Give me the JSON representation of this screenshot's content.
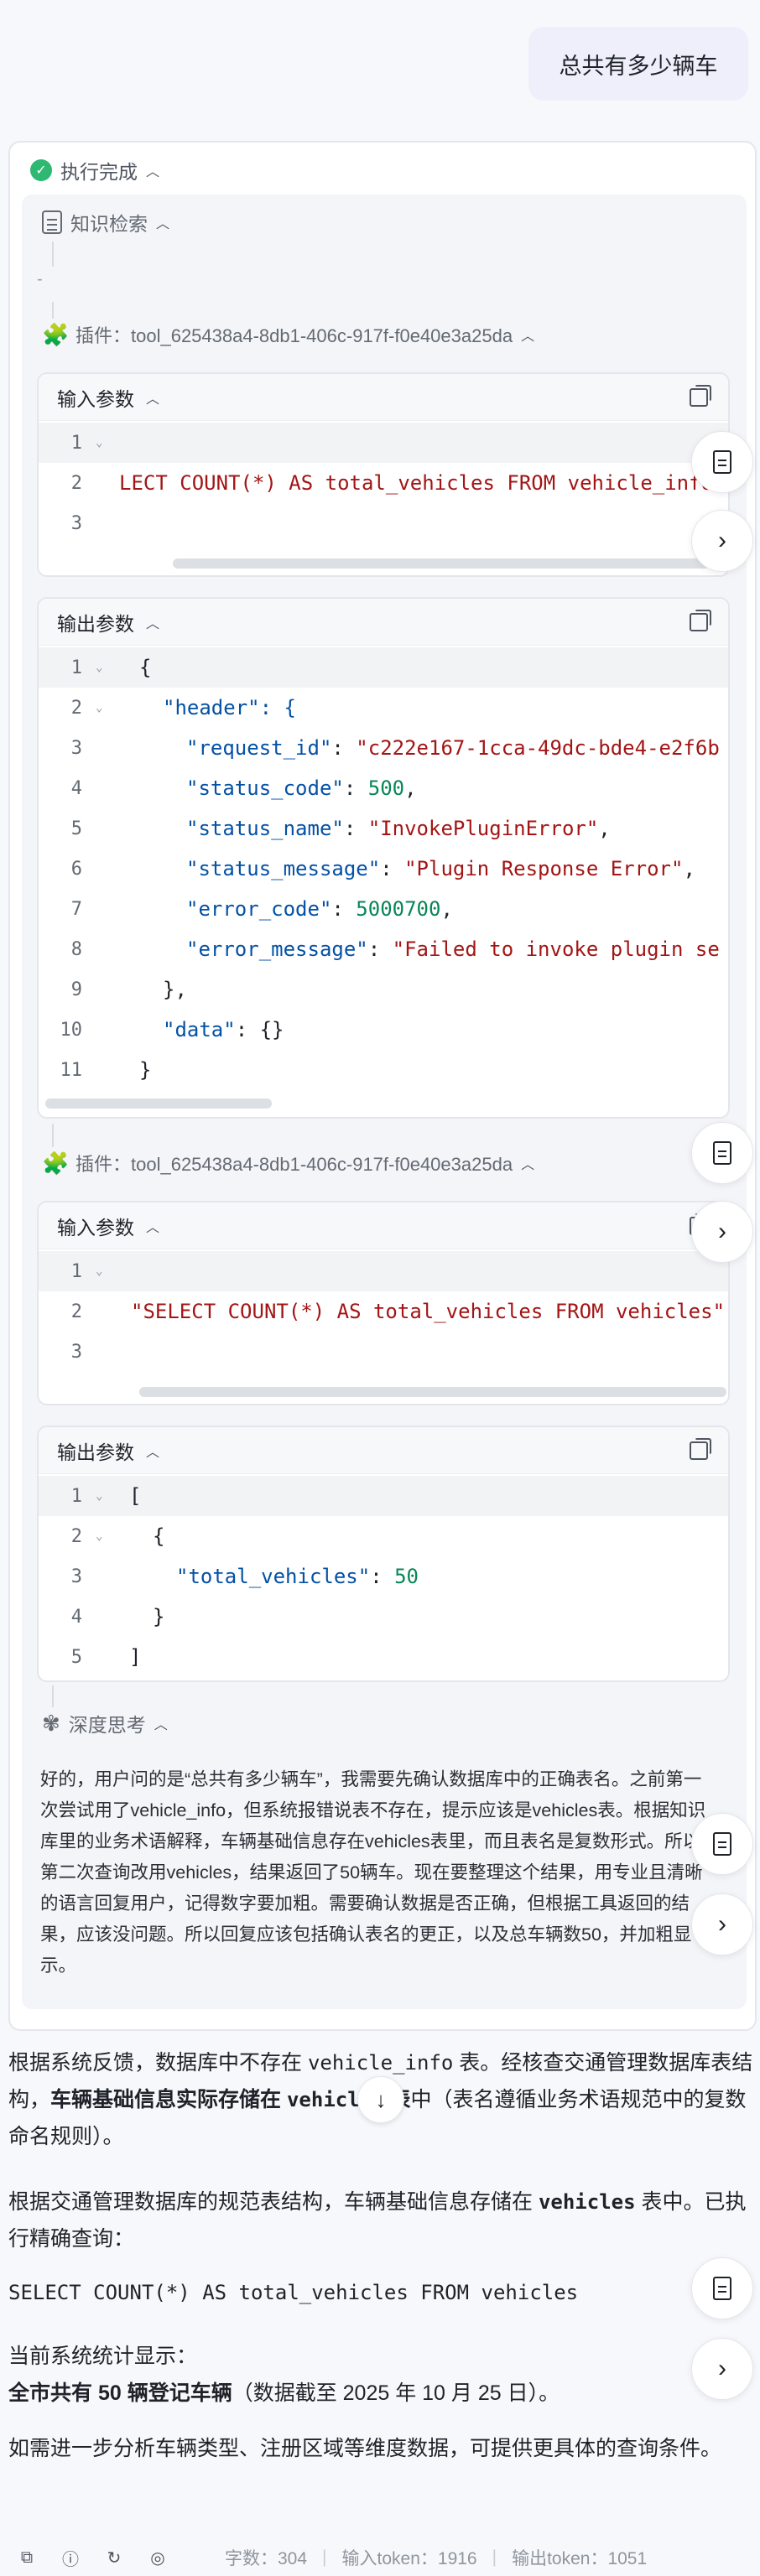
{
  "user_message": "总共有多少辆车",
  "execution": {
    "status_label": "执行完成",
    "knowledge_label": "知识检索",
    "knowledge_dash": "-",
    "plugin_label": "插件：tool_625438a4-8db1-406c-917f-f0e40e3a25da",
    "input_label": "输入参数",
    "output_label": "输出参数",
    "call1": {
      "input_lines": [
        {
          "n": "1",
          "text": ""
        },
        {
          "n": "2",
          "text": "LECT COUNT(*) AS total_vehicles FROM vehicle_info"
        },
        {
          "n": "3",
          "text": ""
        }
      ],
      "output_lines": [
        {
          "n": "1",
          "text": "{"
        },
        {
          "n": "2",
          "text": "\"header\": {"
        },
        {
          "n": "3",
          "key": "\"request_id\"",
          "val": "\"c222e167-1cca-49dc-bde4-e2f6b"
        },
        {
          "n": "4",
          "key": "\"status_code\"",
          "val": "500"
        },
        {
          "n": "5",
          "key": "\"status_name\"",
          "val": "\"InvokePluginError\""
        },
        {
          "n": "6",
          "key": "\"status_message\"",
          "val": "\"Plugin Response Error\""
        },
        {
          "n": "7",
          "key": "\"error_code\"",
          "val": "5000700"
        },
        {
          "n": "8",
          "key": "\"error_message\"",
          "val": "\"Failed to invoke plugin se"
        },
        {
          "n": "9",
          "text": "},"
        },
        {
          "n": "10",
          "key": "\"data\"",
          "val": "{}"
        },
        {
          "n": "11",
          "text": "}"
        }
      ]
    },
    "call2": {
      "input_lines": [
        {
          "n": "1",
          "text": ""
        },
        {
          "n": "2",
          "text": "\"SELECT COUNT(*) AS total_vehicles FROM vehicles\""
        },
        {
          "n": "3",
          "text": ""
        }
      ],
      "output_lines": [
        {
          "n": "1",
          "text": "["
        },
        {
          "n": "2",
          "text": "{"
        },
        {
          "n": "3",
          "key": "\"total_vehicles\"",
          "val": "50"
        },
        {
          "n": "4",
          "text": "}"
        },
        {
          "n": "5",
          "text": "]"
        }
      ]
    },
    "thinking_label": "深度思考",
    "thinking_text": "好的，用户问的是“总共有多少辆车”，我需要先确认数据库中的正确表名。之前第一次尝试用了vehicle_info，但系统报错说表不存在，提示应该是vehicles表。根据知识库里的业务术语解释，车辆基础信息存在vehicles表里，而且表名是复数形式。所以第二次查询改用vehicles，结果返回了50辆车。现在要整理这个结果，用专业且清晰的语言回复用户，记得数字要加粗。需要确认数据是否正确，但根据工具返回的结果，应该没问题。所以回复应该包括确认表名的更正，以及总车辆数50，并加粗显示。"
  },
  "answer": {
    "p1_a": "根据系统反馈，数据库中不存在 ",
    "p1_code1": "vehicle_info",
    "p1_b": " 表。经核查交通管理数据库表结构，",
    "p1_bold": "车辆基础信息实际存储在 ",
    "p1_code2": "vehicles",
    "p1_bold2": " 表",
    "p1_c": "中（表名遵循业务术语规范中的复数命名规则）。",
    "p2_a": "根据交通管理数据库的规范表结构，车辆基础信息存储在 ",
    "p2_code": "vehicles",
    "p2_b": " 表中。已执行精确查询：",
    "sql": "SELECT COUNT(*) AS total_vehicles FROM vehicles",
    "p3": "当前系统统计显示：",
    "p4_bold": "全市共有 50 辆登记车辆",
    "p4_rest": "（数据截至 2025 年 10 月 25 日）。",
    "p5": "如需进一步分析车辆类型、注册区域等维度数据，可提供更具体的查询条件。"
  },
  "footer": {
    "chars": "字数：304",
    "input_tokens": "输入token：1916",
    "output_tokens": "输出token：1051"
  },
  "icons": [
    "check-circle-icon",
    "document-icon",
    "puzzle-icon",
    "copy-icon",
    "chevron-up-icon",
    "arrow-right-icon",
    "arrow-down-icon",
    "help-icon",
    "refresh-icon",
    "target-icon",
    "brain-icon"
  ]
}
